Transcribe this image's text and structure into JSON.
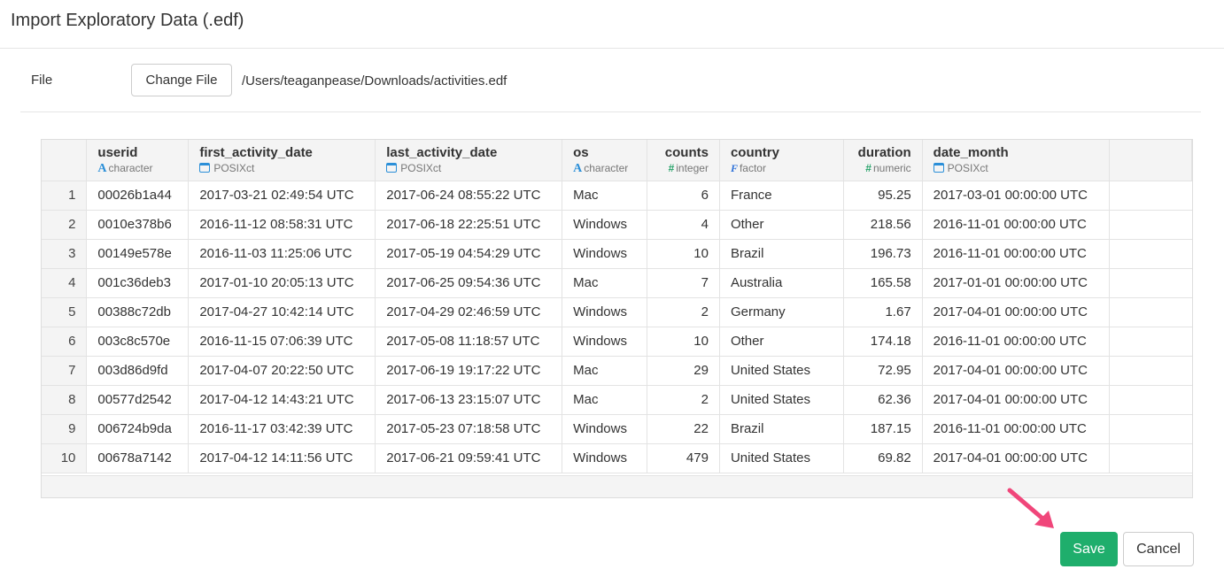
{
  "dialog": {
    "title": "Import Exploratory Data (.edf)"
  },
  "file": {
    "label": "File",
    "change_button": "Change File",
    "path": "/Users/teaganpease/Downloads/activities.edf"
  },
  "table": {
    "columns": [
      {
        "name": "userid",
        "type": "character",
        "icon": "character-icon"
      },
      {
        "name": "first_activity_date",
        "type": "POSIXct",
        "icon": "calendar-icon"
      },
      {
        "name": "last_activity_date",
        "type": "POSIXct",
        "icon": "calendar-icon"
      },
      {
        "name": "os",
        "type": "character",
        "icon": "character-icon"
      },
      {
        "name": "counts",
        "type": "integer",
        "icon": "hash-icon"
      },
      {
        "name": "country",
        "type": "factor",
        "icon": "factor-icon"
      },
      {
        "name": "duration",
        "type": "numeric",
        "icon": "hash-icon"
      },
      {
        "name": "date_month",
        "type": "POSIXct",
        "icon": "calendar-icon"
      }
    ],
    "rows": [
      [
        "1",
        "00026b1a44",
        "2017-03-21 02:49:54 UTC",
        "2017-06-24 08:55:22 UTC",
        "Mac",
        "6",
        "France",
        "95.25",
        "2017-03-01 00:00:00 UTC"
      ],
      [
        "2",
        "0010e378b6",
        "2016-11-12 08:58:31 UTC",
        "2017-06-18 22:25:51 UTC",
        "Windows",
        "4",
        "Other",
        "218.56",
        "2016-11-01 00:00:00 UTC"
      ],
      [
        "3",
        "00149e578e",
        "2016-11-03 11:25:06 UTC",
        "2017-05-19 04:54:29 UTC",
        "Windows",
        "10",
        "Brazil",
        "196.73",
        "2016-11-01 00:00:00 UTC"
      ],
      [
        "4",
        "001c36deb3",
        "2017-01-10 20:05:13 UTC",
        "2017-06-25 09:54:36 UTC",
        "Mac",
        "7",
        "Australia",
        "165.58",
        "2017-01-01 00:00:00 UTC"
      ],
      [
        "5",
        "00388c72db",
        "2017-04-27 10:42:14 UTC",
        "2017-04-29 02:46:59 UTC",
        "Windows",
        "2",
        "Germany",
        "1.67",
        "2017-04-01 00:00:00 UTC"
      ],
      [
        "6",
        "003c8c570e",
        "2016-11-15 07:06:39 UTC",
        "2017-05-08 11:18:57 UTC",
        "Windows",
        "10",
        "Other",
        "174.18",
        "2016-11-01 00:00:00 UTC"
      ],
      [
        "7",
        "003d86d9fd",
        "2017-04-07 20:22:50 UTC",
        "2017-06-19 19:17:22 UTC",
        "Mac",
        "29",
        "United States",
        "72.95",
        "2017-04-01 00:00:00 UTC"
      ],
      [
        "8",
        "00577d2542",
        "2017-04-12 14:43:21 UTC",
        "2017-06-13 23:15:07 UTC",
        "Mac",
        "2",
        "United States",
        "62.36",
        "2017-04-01 00:00:00 UTC"
      ],
      [
        "9",
        "006724b9da",
        "2016-11-17 03:42:39 UTC",
        "2017-05-23 07:18:58 UTC",
        "Windows",
        "22",
        "Brazil",
        "187.15",
        "2016-11-01 00:00:00 UTC"
      ],
      [
        "10",
        "00678a7142",
        "2017-04-12 14:11:56 UTC",
        "2017-06-21 09:59:41 UTC",
        "Windows",
        "479",
        "United States",
        "69.82",
        "2017-04-01 00:00:00 UTC"
      ]
    ]
  },
  "actions": {
    "save": "Save",
    "cancel": "Cancel",
    "save_color": "#1fae6c",
    "arrow_color": "#f0467a"
  }
}
